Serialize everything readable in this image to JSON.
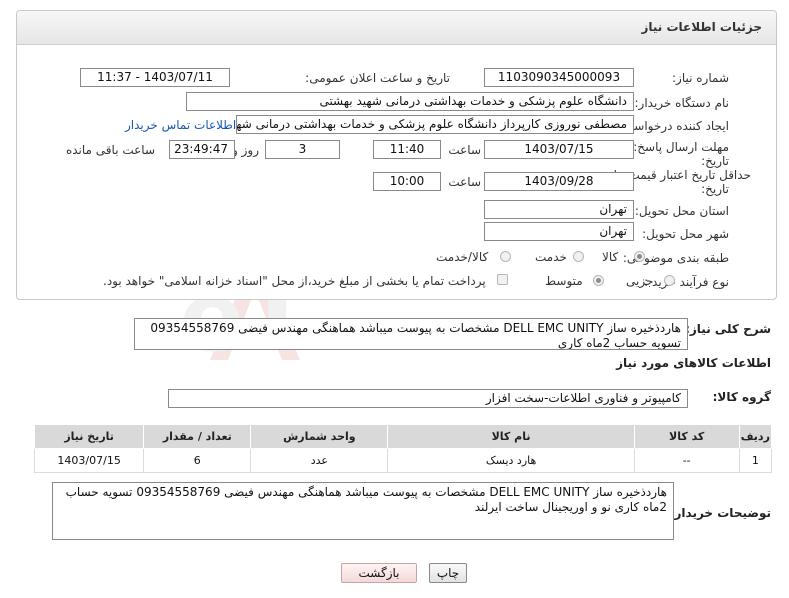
{
  "header": {
    "title": "جزئیات اطلاعات نیاز"
  },
  "fields": {
    "need_number_label": "شماره نیاز:",
    "need_number": "1103090345000093",
    "announce_label": "تاریخ و ساعت اعلان عمومی:",
    "announce_value": "1403/07/11 - 11:37",
    "buyer_label": "نام دستگاه خریدار:",
    "buyer_value": "دانشگاه علوم پزشکی و خدمات بهداشتی درمانی شهید بهشتی",
    "requester_label": "ایجاد کننده درخواست:",
    "requester_value": "مصطفی نوروزی کارپرداز دانشگاه علوم پزشکی و خدمات بهداشتی درمانی شهید",
    "contact_link": "اطلاعات تماس خریدار",
    "deadline_label_1": "مهلت ارسال پاسخ: تا",
    "deadline_label_2": "تاریخ:",
    "deadline_date": "1403/07/15",
    "hour_label": "ساعت",
    "deadline_time": "11:40",
    "days_value": "3",
    "days_label": "روز و",
    "remaining_time": "23:49:47",
    "remaining_label": "ساعت باقی مانده",
    "validity_label_1": "حداقل تاریخ اعتبار قیمت: تا",
    "validity_label_2": "تاریخ:",
    "validity_date": "1403/09/28",
    "validity_time": "10:00",
    "province_label": "استان محل تحویل:",
    "province_value": "تهران",
    "city_label": "شهر محل تحویل:",
    "city_value": "تهران",
    "category_label": "طبقه بندی موضوعی:",
    "category_options": [
      "کالا",
      "خدمت",
      "کالا/خدمت"
    ],
    "process_label": "نوع فرآیند خرید :",
    "process_options": [
      "جزیی",
      "متوسط"
    ],
    "payment_note": "پرداخت تمام یا بخشی از مبلغ خرید،از محل \"اسناد خزانه اسلامی\" خواهد بود."
  },
  "description": {
    "label": "شرح کلی نیاز:",
    "text": "هاردذخیره ساز DELL EMC UNITY مشخصات به پیوست میباشد هماهنگی مهندس فیضی 09354558769 تسویه حساب 2ماه کاری"
  },
  "goods": {
    "section_title": "اطلاعات کالاهای مورد نیاز",
    "group_label": "گروه کالا:",
    "group_value": "کامپیوتر و فناوری اطلاعات-سخت افزار",
    "columns": [
      "ردیف",
      "کد کالا",
      "نام کالا",
      "واحد شمارش",
      "تعداد / مقدار",
      "تاریخ نیاز"
    ],
    "rows": [
      [
        "1",
        "--",
        "هارد دیسک",
        "عدد",
        "6",
        "1403/07/15"
      ]
    ]
  },
  "buyer_notes": {
    "label": "توضیحات خریدار:",
    "text": "هاردذخیره ساز DELL EMC UNITY مشخصات به پیوست میباشد هماهنگی مهندس فیضی 09354558769 تسویه حساب 2ماه کاری نو و اوریجینال ساخت ایرلند"
  },
  "buttons": {
    "print": "چاپ",
    "back": "بازگشت"
  },
  "watermark": {
    "text": "AriaTender.neT"
  },
  "colors": {
    "link": "#1a57b5",
    "header_bg": "#e6e6e6",
    "table_header": "#d9d9d9",
    "watermark": "#d33"
  }
}
